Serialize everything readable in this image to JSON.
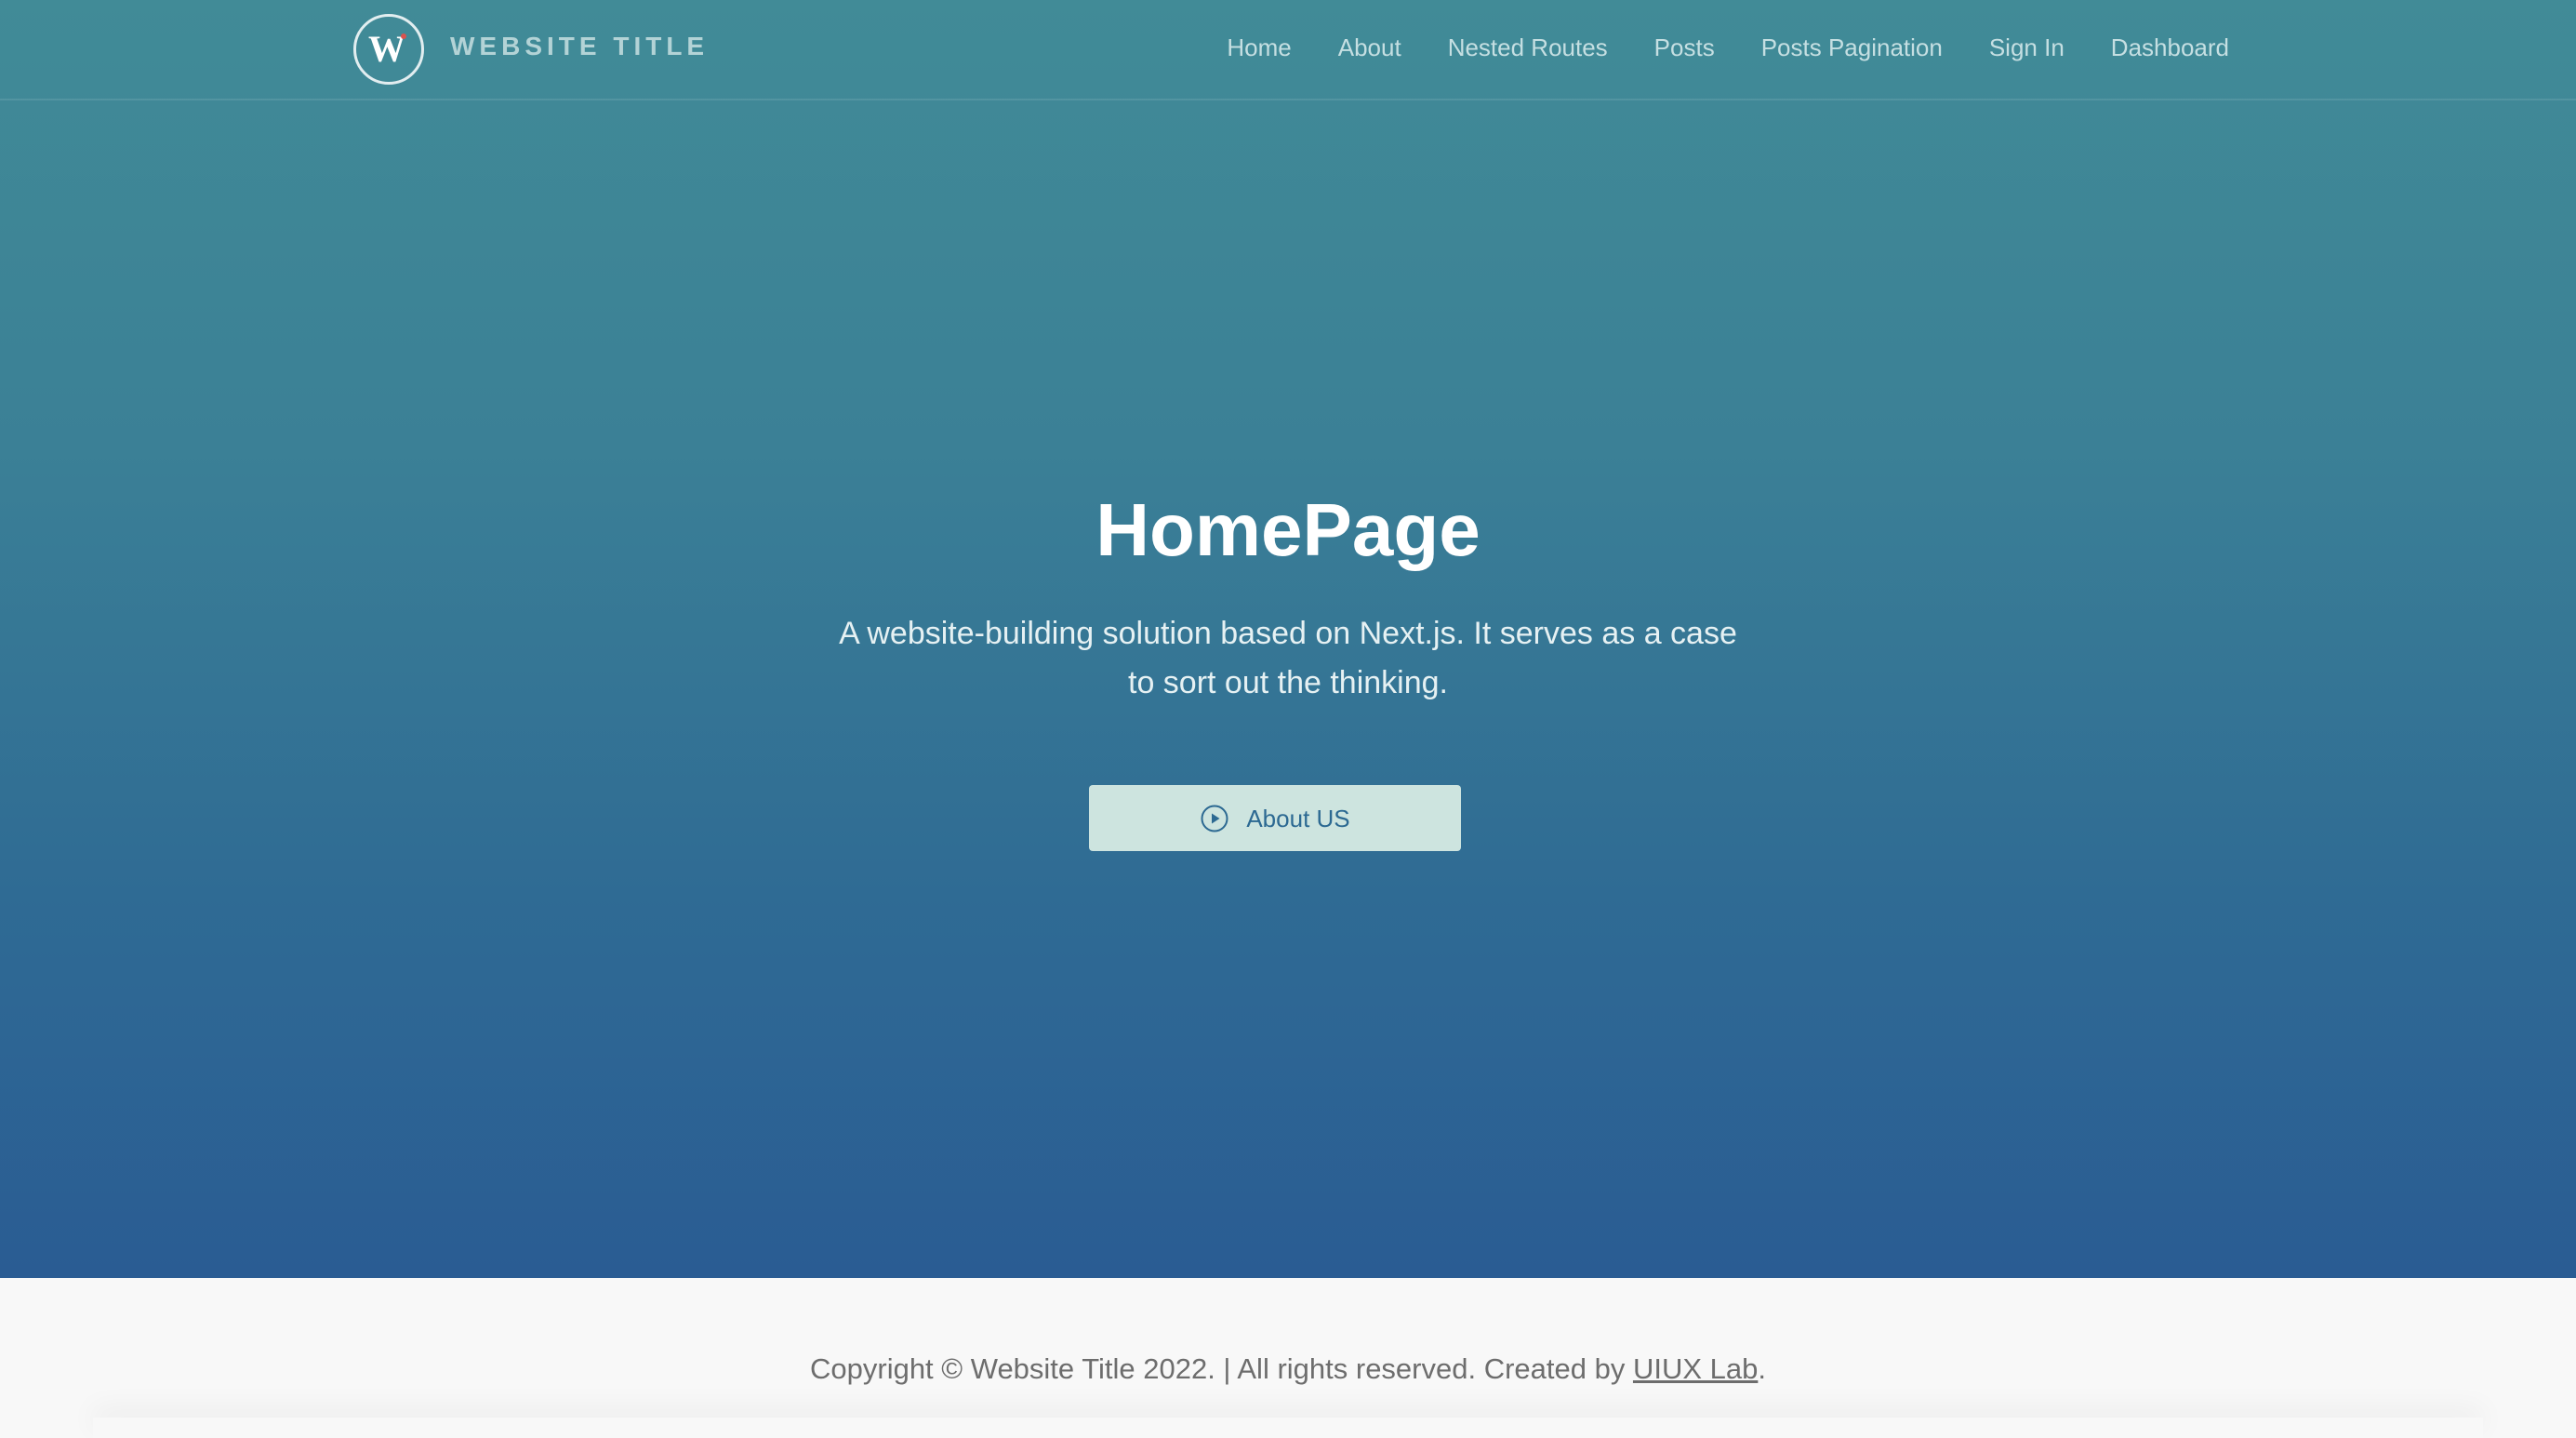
{
  "header": {
    "logo_letter": "W",
    "site_title": "WEBSITE TITLE",
    "nav": [
      {
        "label": "Home"
      },
      {
        "label": "About"
      },
      {
        "label": "Nested Routes"
      },
      {
        "label": "Posts"
      },
      {
        "label": "Posts Pagination"
      },
      {
        "label": "Sign In"
      },
      {
        "label": "Dashboard"
      }
    ]
  },
  "hero": {
    "title": "HomePage",
    "subtitle": "A website-building solution based on Next.js. It serves as a case to sort out the thinking.",
    "button": {
      "label": "About US",
      "icon": "play-circle-icon"
    }
  },
  "footer": {
    "text_before": "Copyright © Website Title 2022. | All rights reserved. Created by ",
    "link_label": "UIUX Lab",
    "text_after": "."
  },
  "colors": {
    "gradient_top": "#418b97",
    "gradient_bottom": "#2a5c93",
    "button_bg": "#cde4df",
    "button_text": "#2c6992",
    "footer_bg": "#f8f8f8",
    "logo_accent": "#d9534f"
  }
}
